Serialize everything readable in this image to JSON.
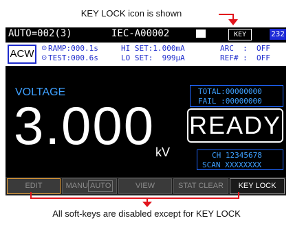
{
  "annotations": {
    "top": "KEY LOCK icon is shown",
    "bottom": "All soft-keys are disabled except for KEY LOCK"
  },
  "status": {
    "mode_index": "AUTO=002(3)",
    "file_name": "IEC-A00002",
    "keylock_icon": "KEY",
    "interface_tag": "232"
  },
  "test_panel": {
    "mode": "ACW",
    "ramp": "RAMP:000.1s",
    "test": "TEST:000.6s",
    "hi_set": "HI SET:1.000mA",
    "lo_set": "LO SET:  999μA",
    "arc": "ARC  :  OFF",
    "ref": "REF# :  OFF"
  },
  "measurement": {
    "label": "VOLTAGE",
    "value": "3.000",
    "unit": "kV"
  },
  "counters": {
    "total": "TOTAL:00000000",
    "fail": "FAIL :00000000"
  },
  "status_display": "READY",
  "channels": {
    "ch_row": "CH 12345678",
    "scan_row": "SCAN XXXXXXXX"
  },
  "softkeys": [
    {
      "label": "EDIT"
    },
    {
      "label": "MANU",
      "label2": "AUTO"
    },
    {
      "label": "VIEW"
    },
    {
      "label": "STAT CLEAR"
    },
    {
      "label": "KEY LOCK"
    }
  ],
  "colors": {
    "annotation_red": "#e2141c",
    "accent_blue": "#1d2bcc",
    "text_blue": "#3ea0ff"
  }
}
